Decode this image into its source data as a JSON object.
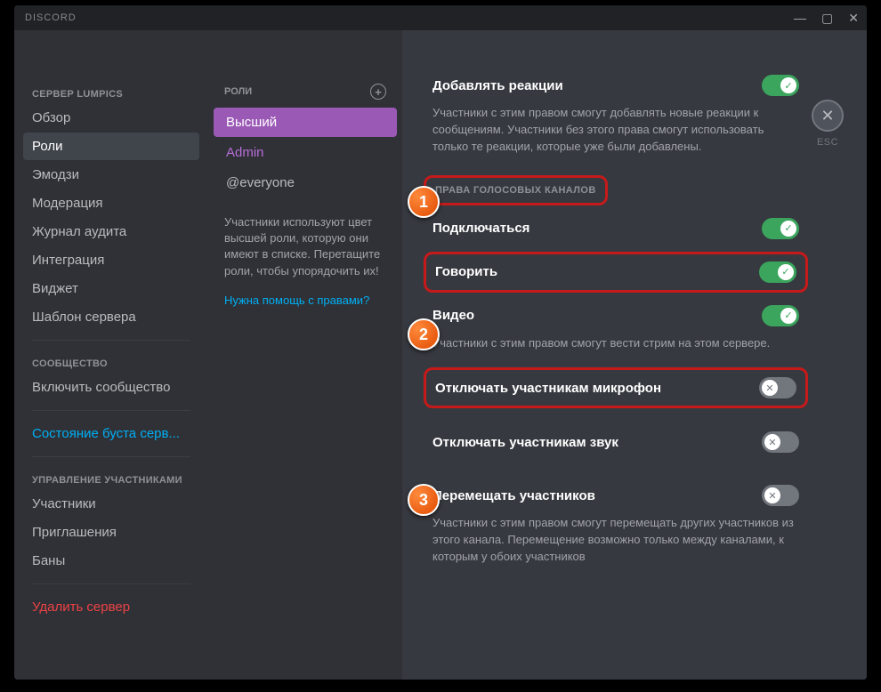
{
  "titlebar": {
    "brand": "DISCORD"
  },
  "close": {
    "esc": "ESC"
  },
  "sidebar": {
    "cat_server": "СЕРВЕР LUMPICS",
    "items_server": [
      "Обзор",
      "Роли",
      "Эмодзи",
      "Модерация",
      "Журнал аудита",
      "Интеграция",
      "Виджет",
      "Шаблон сервера"
    ],
    "cat_community": "СООБЩЕСТВО",
    "item_enable_community": "Включить сообщество",
    "item_boost": "Состояние буста серв...",
    "cat_members": "УПРАВЛЕНИЕ УЧАСТНИКАМИ",
    "items_members": [
      "Участники",
      "Приглашения",
      "Баны"
    ],
    "item_delete": "Удалить сервер"
  },
  "roles": {
    "header": "РОЛИ",
    "list": [
      {
        "name": "Высший",
        "selected": true
      },
      {
        "name": "Admin",
        "cls": "admin"
      },
      {
        "name": "@everyone",
        "cls": "everyone"
      }
    ],
    "hint": "Участники используют цвет высшей роли, которую они имеют в списке. Перетащите роли, чтобы упорядочить их!",
    "help": "Нужна помощь с правами?"
  },
  "perms": {
    "add_reactions": {
      "title": "Добавлять реакции",
      "desc": "Участники с этим правом смогут добавлять новые реакции к сообщениям. Участники без этого права смогут использовать только те реакции, которые уже были добавлены.",
      "on": true
    },
    "voice_header": "ПРАВА ГОЛОСОВЫХ КАНАЛОВ",
    "connect": {
      "title": "Подключаться",
      "on": true
    },
    "speak": {
      "title": "Говорить",
      "on": true
    },
    "video": {
      "title": "Видео",
      "desc": "Участники с этим правом смогут вести стрим на этом сервере.",
      "on": true
    },
    "mute": {
      "title": "Отключать участникам микрофон",
      "on": false
    },
    "deafen": {
      "title": "Отключать участникам звук",
      "on": false
    },
    "move": {
      "title": "Перемещать участников",
      "desc": "Участники с этим правом смогут перемещать других участников из этого канала. Перемещение возможно только между каналами, к которым у обоих участников",
      "on": false
    }
  },
  "callouts": {
    "c1": "1",
    "c2": "2",
    "c3": "3"
  }
}
